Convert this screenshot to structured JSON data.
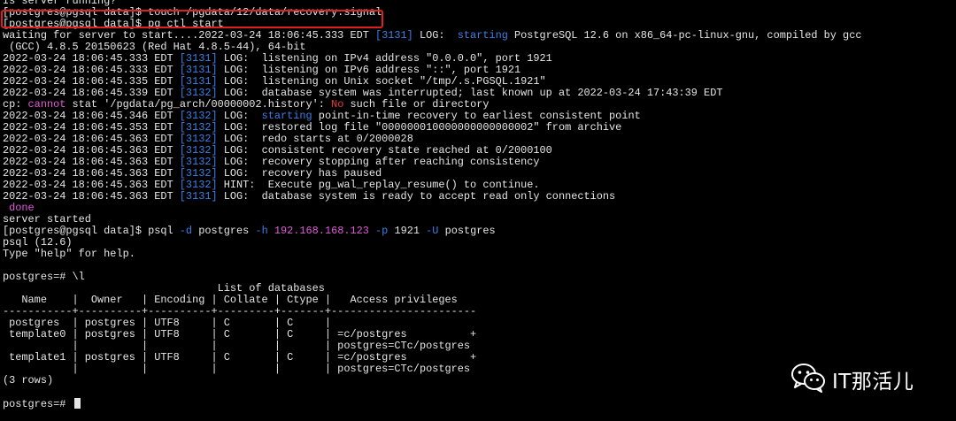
{
  "terminal": {
    "lines": [
      [
        {
          "t": "Is server running?"
        }
      ],
      [
        {
          "t": "[postgres@pgsql data]$ touch /pgdata/12/data/recovery.signal"
        }
      ],
      [
        {
          "t": "[postgres@pgsql data]$ pg_ctl start"
        }
      ],
      [
        {
          "t": "waiting for server to start....2022-03-24 18:06:45.333 EDT "
        },
        {
          "t": "[3131]",
          "c": "blue"
        },
        {
          "t": " LOG:  "
        },
        {
          "t": "starting",
          "c": "blue"
        },
        {
          "t": " PostgreSQL 12.6 on x86_64-pc-linux-gnu, compiled by gcc"
        }
      ],
      [
        {
          "t": " (GCC) 4.8.5 20150623 (Red Hat 4.8.5-44), 64-bit"
        }
      ],
      [
        {
          "t": "2022-03-24 18:06:45.333 EDT "
        },
        {
          "t": "[3131]",
          "c": "blue"
        },
        {
          "t": " LOG:  listening on IPv4 address \"0.0.0.0\", port 1921"
        }
      ],
      [
        {
          "t": "2022-03-24 18:06:45.333 EDT "
        },
        {
          "t": "[3131]",
          "c": "blue"
        },
        {
          "t": " LOG:  listening on IPv6 address \"::\", port 1921"
        }
      ],
      [
        {
          "t": "2022-03-24 18:06:45.335 EDT "
        },
        {
          "t": "[3131]",
          "c": "blue"
        },
        {
          "t": " LOG:  listening on Unix socket \"/tmp/.s.PGSQL.1921\""
        }
      ],
      [
        {
          "t": "2022-03-24 18:06:45.339 EDT "
        },
        {
          "t": "[3132]",
          "c": "blue"
        },
        {
          "t": " LOG:  database system was interrupted; last known up at 2022-03-24 17:43:39 EDT"
        }
      ],
      [
        {
          "t": "cp: "
        },
        {
          "t": "cannot",
          "c": "pink"
        },
        {
          "t": " stat '/pgdata/pg_arch/00000002.history': "
        },
        {
          "t": "No",
          "c": "red"
        },
        {
          "t": " such file or directory"
        }
      ],
      [
        {
          "t": "2022-03-24 18:06:45.346 EDT "
        },
        {
          "t": "[3132]",
          "c": "blue"
        },
        {
          "t": " LOG:  "
        },
        {
          "t": "starting",
          "c": "blue"
        },
        {
          "t": " point-in-time recovery to earliest consistent point"
        }
      ],
      [
        {
          "t": "2022-03-24 18:06:45.353 EDT "
        },
        {
          "t": "[3132]",
          "c": "blue"
        },
        {
          "t": " LOG:  restored log file \"000000010000000000000002\" from archive"
        }
      ],
      [
        {
          "t": "2022-03-24 18:06:45.363 EDT "
        },
        {
          "t": "[3132]",
          "c": "blue"
        },
        {
          "t": " LOG:  redo starts at 0/2000028"
        }
      ],
      [
        {
          "t": "2022-03-24 18:06:45.363 EDT "
        },
        {
          "t": "[3132]",
          "c": "blue"
        },
        {
          "t": " LOG:  consistent recovery state reached at 0/2000100"
        }
      ],
      [
        {
          "t": "2022-03-24 18:06:45.363 EDT "
        },
        {
          "t": "[3132]",
          "c": "blue"
        },
        {
          "t": " LOG:  recovery stopping after reaching consistency"
        }
      ],
      [
        {
          "t": "2022-03-24 18:06:45.363 EDT "
        },
        {
          "t": "[3132]",
          "c": "blue"
        },
        {
          "t": " LOG:  recovery has paused"
        }
      ],
      [
        {
          "t": "2022-03-24 18:06:45.363 EDT "
        },
        {
          "t": "[3132]",
          "c": "blue"
        },
        {
          "t": " HINT:  Execute pg_wal_replay_resume() to continue."
        }
      ],
      [
        {
          "t": "2022-03-24 18:06:45.363 EDT "
        },
        {
          "t": "[3131]",
          "c": "blue"
        },
        {
          "t": " LOG:  database system is ready to accept read only connections"
        }
      ],
      [
        {
          "t": " done",
          "c": "pink"
        }
      ],
      [
        {
          "t": "server started"
        }
      ],
      [
        {
          "t": "[postgres@pgsql data]$ psql "
        },
        {
          "t": "-d",
          "c": "blue"
        },
        {
          "t": " postgres "
        },
        {
          "t": "-h",
          "c": "blue"
        },
        {
          "t": " "
        },
        {
          "t": "192.168.168.123",
          "c": "pink"
        },
        {
          "t": " "
        },
        {
          "t": "-p",
          "c": "blue"
        },
        {
          "t": " 1921 "
        },
        {
          "t": "-U",
          "c": "blue"
        },
        {
          "t": " postgres"
        }
      ],
      [
        {
          "t": "psql (12.6)"
        }
      ],
      [
        {
          "t": "Type \"help\" for help."
        }
      ],
      [
        {
          "t": ""
        }
      ],
      [
        {
          "t": "postgres=# \\l"
        }
      ],
      [
        {
          "t": "                                  List of databases"
        }
      ],
      [
        {
          "t": "   Name    |  Owner   | Encoding | Collate | Ctype |   Access privileges"
        }
      ],
      [
        {
          "t": "-----------+----------+----------+---------+-------+-----------------------"
        }
      ],
      [
        {
          "t": " postgres  | postgres | UTF8     | C       | C     |"
        }
      ],
      [
        {
          "t": " template0 | postgres | UTF8     | C       | C     | =c/postgres          +"
        }
      ],
      [
        {
          "t": "           |          |          |         |       | postgres=CTc/postgres"
        }
      ],
      [
        {
          "t": " template1 | postgres | UTF8     | C       | C     | =c/postgres          +"
        }
      ],
      [
        {
          "t": "           |          |          |         |       | postgres=CTc/postgres"
        }
      ],
      [
        {
          "t": "(3 rows)"
        }
      ],
      [
        {
          "t": ""
        }
      ],
      [
        {
          "t": "postgres=# "
        }
      ]
    ]
  },
  "watermark": {
    "text": "IT那活儿",
    "icon": "wechat-icon"
  },
  "colors": {
    "background": "#000000",
    "text": "#e6e6e6",
    "blue": "#3d7fe6",
    "pink": "#e05ad8",
    "red": "#e8383d",
    "highlight_box": "#e02020"
  }
}
